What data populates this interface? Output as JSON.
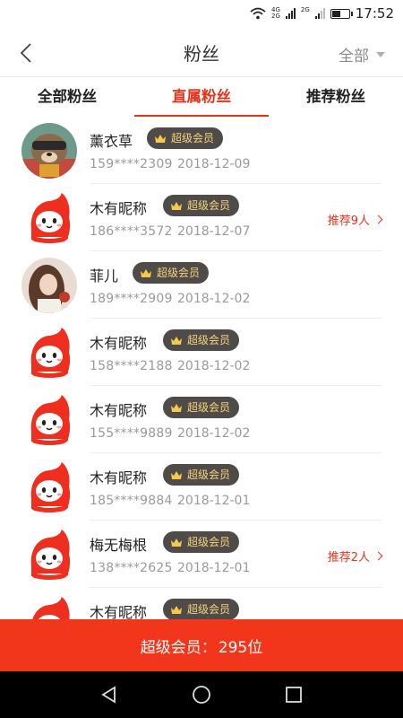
{
  "status_bar": {
    "network_top": "4G",
    "network_bottom": "2G",
    "network_2": "2G",
    "time": "17:52"
  },
  "header": {
    "title": "粉丝",
    "filter_label": "全部",
    "back_icon": "chevron-left-icon"
  },
  "tabs": [
    {
      "label": "全部粉丝",
      "active": false
    },
    {
      "label": "直属粉丝",
      "active": true
    },
    {
      "label": "推荐粉丝",
      "active": false
    }
  ],
  "badge_label": "超级会员",
  "fans": [
    {
      "name": "薰衣草",
      "phone": "159****2309",
      "date": "2018-12-09",
      "avatar": "photo-bear",
      "recommend": ""
    },
    {
      "name": "木有昵称",
      "phone": "186****3572",
      "date": "2018-12-07",
      "avatar": "default-mascot",
      "recommend": "推荐9人"
    },
    {
      "name": "菲儿",
      "phone": "189****2909",
      "date": "2018-12-02",
      "avatar": "photo-woman",
      "recommend": ""
    },
    {
      "name": "木有昵称",
      "phone": "158****2188",
      "date": "2018-12-02",
      "avatar": "default-mascot",
      "recommend": ""
    },
    {
      "name": "木有昵称",
      "phone": "155****9889",
      "date": "2018-12-02",
      "avatar": "default-mascot",
      "recommend": ""
    },
    {
      "name": "木有昵称",
      "phone": "185****9884",
      "date": "2018-12-01",
      "avatar": "default-mascot",
      "recommend": ""
    },
    {
      "name": "梅无梅根",
      "phone": "138****2625",
      "date": "2018-12-01",
      "avatar": "default-mascot",
      "recommend": "推荐2人"
    },
    {
      "name": "木有昵称",
      "phone": "",
      "date": "",
      "avatar": "default-mascot",
      "recommend": ""
    }
  ],
  "footer": {
    "label": "超级会员：",
    "count": "295位"
  },
  "colors": {
    "accent": "#e8321c",
    "bottom_bar": "#f2361c",
    "badge_bg": "#4e4b48",
    "badge_text": "#f6d27a"
  }
}
